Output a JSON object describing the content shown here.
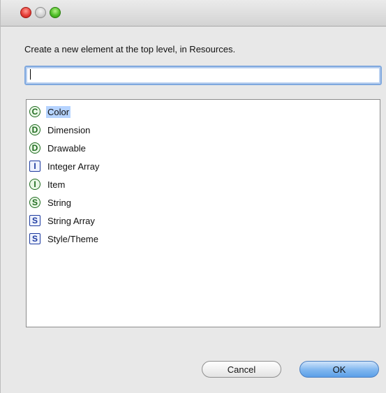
{
  "dialog": {
    "message": "Create a new element at the top level, in Resources.",
    "search": {
      "value": "",
      "placeholder": ""
    }
  },
  "list": {
    "items": [
      {
        "label": "Color",
        "icon_letter": "C",
        "icon_shape": "circle",
        "selected": true
      },
      {
        "label": "Dimension",
        "icon_letter": "D",
        "icon_shape": "circle",
        "selected": false
      },
      {
        "label": "Drawable",
        "icon_letter": "D",
        "icon_shape": "circle",
        "selected": false
      },
      {
        "label": "Integer Array",
        "icon_letter": "I",
        "icon_shape": "square",
        "selected": false
      },
      {
        "label": "Item",
        "icon_letter": "I",
        "icon_shape": "circle",
        "selected": false
      },
      {
        "label": "String",
        "icon_letter": "S",
        "icon_shape": "circle",
        "selected": false
      },
      {
        "label": "String Array",
        "icon_letter": "S",
        "icon_shape": "square",
        "selected": false
      },
      {
        "label": "Style/Theme",
        "icon_letter": "S",
        "icon_shape": "square",
        "selected": false
      }
    ]
  },
  "buttons": {
    "cancel": "Cancel",
    "ok": "OK"
  },
  "colors": {
    "selection": "#b5d3ff",
    "circle_icon": "#1e6b1e",
    "square_icon": "#1d3a9e",
    "default_button": "#7fb6ef"
  }
}
